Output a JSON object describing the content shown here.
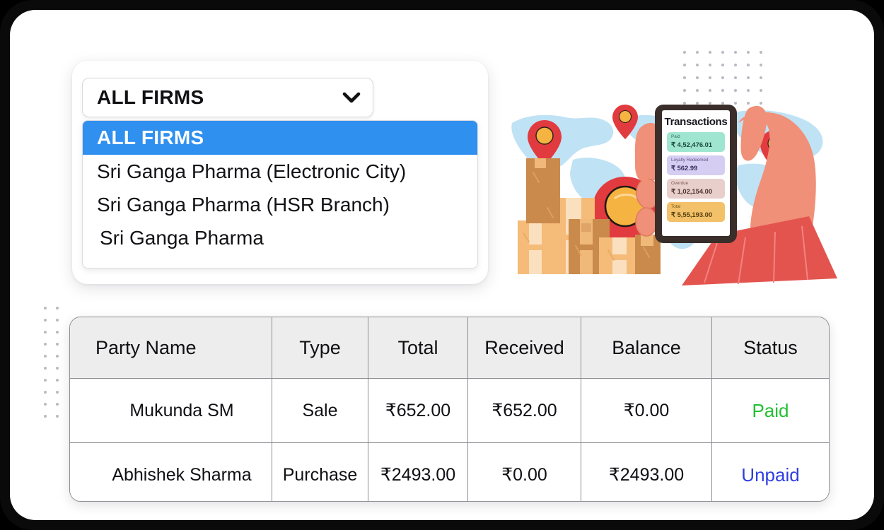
{
  "firm_selector": {
    "selected_label": "ALL FIRMS",
    "chevron_icon": "chevron-down-icon",
    "options": [
      {
        "label": "ALL FIRMS",
        "selected": true
      },
      {
        "label": "Sri Ganga Pharma (Electronic City)",
        "selected": false
      },
      {
        "label": "Sri Ganga Pharma (HSR Branch)",
        "selected": false
      },
      {
        "label": "Sri Ganga Pharma",
        "selected": false
      }
    ]
  },
  "illustration": {
    "name": "global-transactions-illustration",
    "phone": {
      "title": "Transactions",
      "cards": [
        {
          "label": "Paid",
          "value": "₹ 4,52,476.01",
          "bg": "#9fe5cf",
          "label_color": "#3c6f61",
          "value_color": "#1d4b3d"
        },
        {
          "label": "Loyalty Redeemed",
          "value": "₹ 562.99",
          "bg": "#d6cef2",
          "label_color": "#5b4f86",
          "value_color": "#3a2f63"
        },
        {
          "label": "Overdue",
          "value": "₹ 1,02,154.00",
          "bg": "#e8cfcb",
          "label_color": "#7a5a55",
          "value_color": "#4e3531"
        },
        {
          "label": "Total",
          "value": "₹ 5,55,193.00",
          "bg": "#f3c169",
          "label_color": "#7a5a1e",
          "value_color": "#55400f"
        }
      ]
    },
    "colors": {
      "map": "#bfe2f5",
      "pin": "#e23b3f",
      "pin_center": "#f5b342",
      "hand": "#f09078",
      "sleeve": "#e4544f",
      "box_light": "#f5bb78",
      "box_dark": "#c98a4b",
      "phone_body": "#3a2e2b"
    }
  },
  "table": {
    "headers": [
      "Party Name",
      "Type",
      "Total",
      "Received",
      "Balance",
      "Status"
    ],
    "rows": [
      {
        "party_name": "Mukunda SM",
        "type": "Sale",
        "total": "₹652.00",
        "received": "₹652.00",
        "balance": "₹0.00",
        "status": "Paid",
        "status_kind": "paid"
      },
      {
        "party_name": "Abhishek Sharma",
        "type": "Purchase",
        "total": "₹2493.00",
        "received": "₹0.00",
        "balance": "₹2493.00",
        "status": "Unpaid",
        "status_kind": "unpaid"
      }
    ]
  },
  "theme": {
    "accent_blue": "#2f90ef",
    "paid_green": "#22c032",
    "unpaid_blue": "#2f3fe0",
    "header_gray": "#ededed",
    "border_gray": "#8e8e93",
    "frame_dark": "#0a0a0a"
  }
}
